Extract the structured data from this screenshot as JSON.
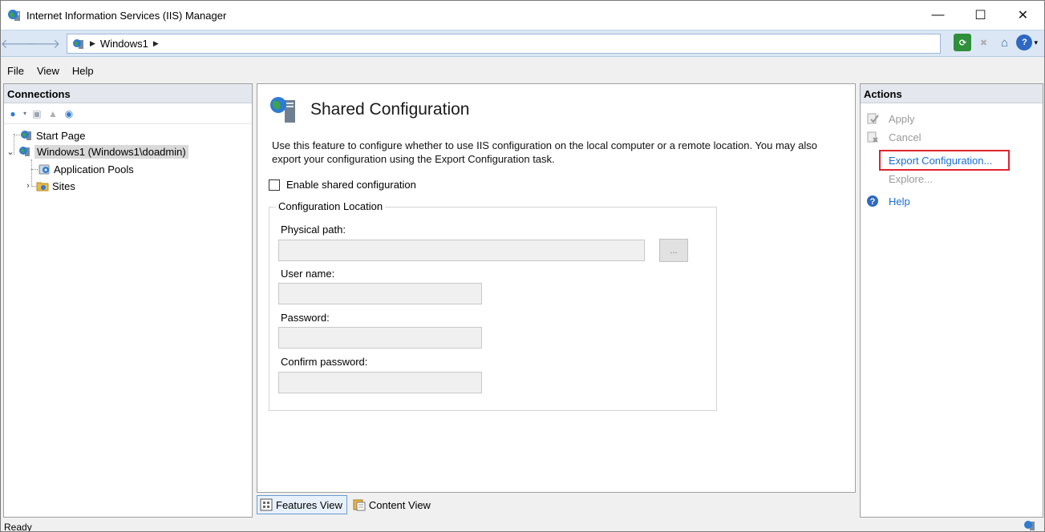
{
  "window": {
    "title": "Internet Information Services (IIS) Manager",
    "controls": {
      "minimize": "—",
      "maximize": "☐",
      "close": "✕"
    }
  },
  "address": {
    "back_icon": "🡐",
    "forward_icon": "🡒",
    "crumbs": [
      "Windows1"
    ]
  },
  "menu": [
    "File",
    "View",
    "Help"
  ],
  "connections": {
    "title": "Connections",
    "tree": [
      {
        "label": "Start Page",
        "icon": "start-page-icon"
      },
      {
        "label": "Windows1 (Windows1\\doadmin)",
        "icon": "server-icon",
        "expanded": true,
        "selected": true
      },
      {
        "label": "Application Pools",
        "icon": "app-pools-icon"
      },
      {
        "label": "Sites",
        "icon": "sites-folder-icon",
        "collapsed": true
      }
    ]
  },
  "main": {
    "title": "Shared Configuration",
    "description": "Use this feature to configure whether to use IIS configuration on the local computer or a remote location. You may also export your configuration using the Export Configuration task.",
    "checkbox_label": "Enable shared configuration",
    "checkbox_checked": false,
    "group_title": "Configuration Location",
    "fields": {
      "physical_path_label": "Physical path:",
      "physical_path_value": "",
      "browse_label": "...",
      "user_name_label": "User name:",
      "user_name_value": "",
      "password_label": "Password:",
      "password_value": "",
      "confirm_password_label": "Confirm password:",
      "confirm_password_value": ""
    }
  },
  "view_tabs": {
    "features": "Features View",
    "content": "Content View",
    "active": "features"
  },
  "actions": {
    "title": "Actions",
    "items": [
      {
        "label": "Apply",
        "enabled": false
      },
      {
        "label": "Cancel",
        "enabled": false
      },
      {
        "label": "Export Configuration...",
        "enabled": true,
        "highlighted": true
      },
      {
        "label": "Explore...",
        "enabled": false
      },
      {
        "label": "Help",
        "enabled": true
      }
    ]
  },
  "status": {
    "text": "Ready"
  },
  "colors": {
    "link": "#1a6dd4",
    "highlight_border": "#e0232e",
    "panel_header": "#e4e8ee",
    "addr_bar": "#dce7f5"
  }
}
